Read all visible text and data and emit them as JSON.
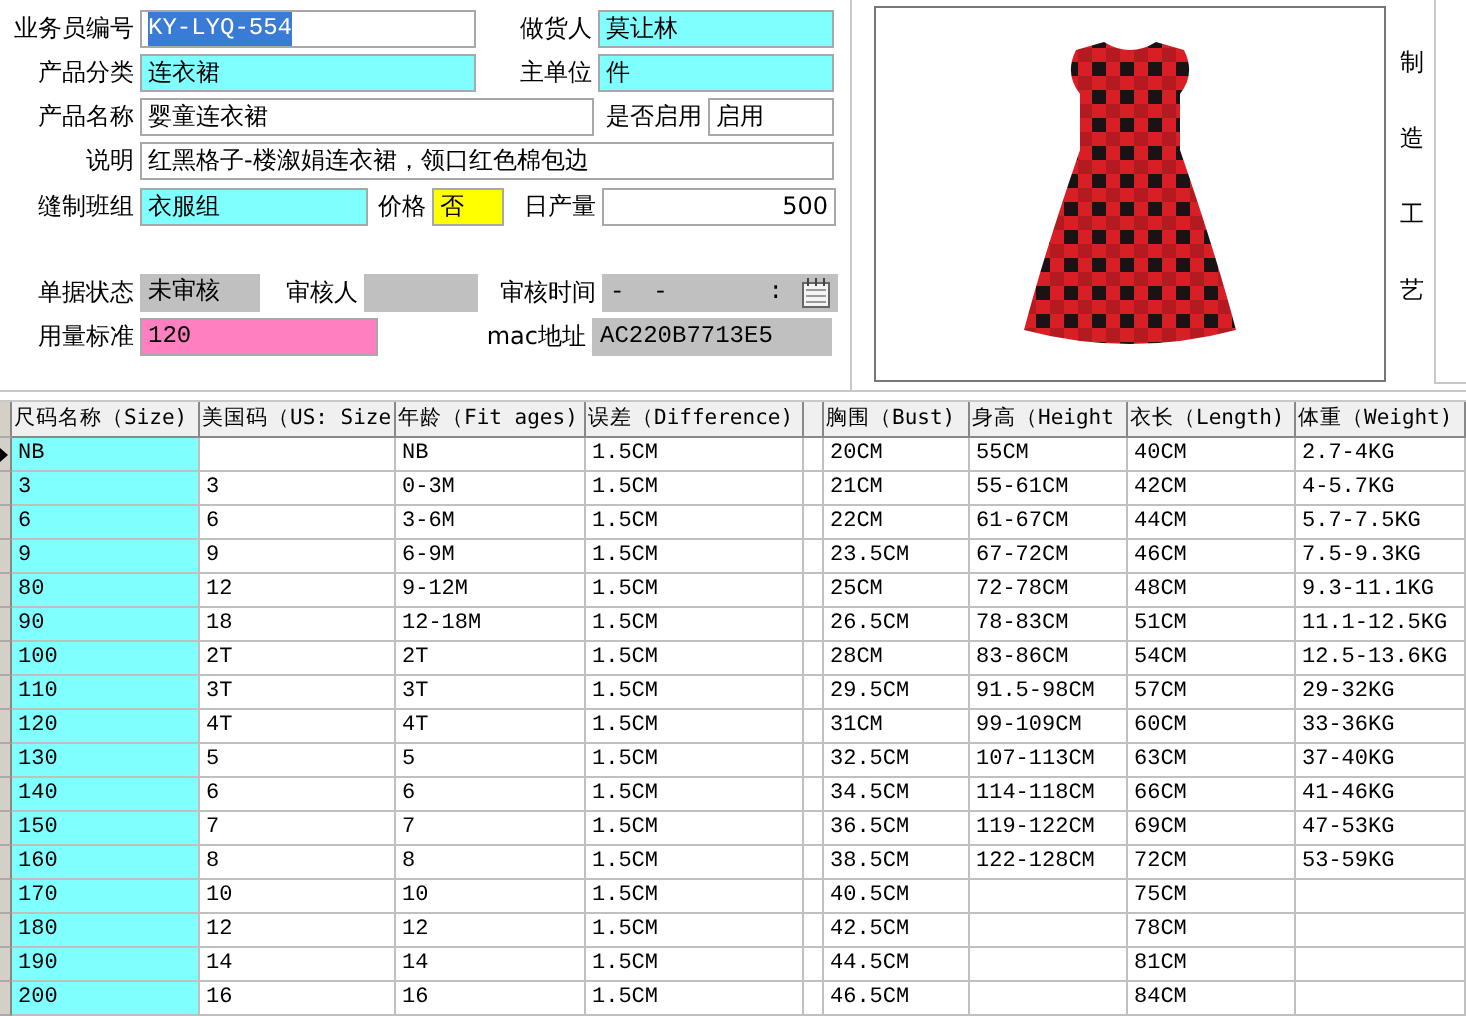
{
  "form": {
    "rows": [
      [
        {
          "label": "业务员编号",
          "value": "KY-LYQ-554",
          "kind": "plain",
          "text_selected": true
        },
        {
          "label": "做货人",
          "value": "莫让林",
          "kind": "required",
          "text_selected": false
        }
      ],
      [
        {
          "label": "产品分类",
          "value": "连衣裙",
          "kind": "required",
          "text_selected": false
        },
        {
          "label": "主单位",
          "value": "件",
          "kind": "required",
          "text_selected": false
        }
      ],
      [
        {
          "label": "产品名称",
          "value": "婴童连衣裙",
          "kind": "plain",
          "text_selected": false
        },
        {
          "label": "是否启用",
          "value": "启用",
          "kind": "plain",
          "text_selected": false
        }
      ],
      [
        {
          "label": "说明",
          "value": "红黑格子-楼溆娟连衣裙，领口红色棉包边",
          "kind": "plain",
          "text_selected": false
        }
      ],
      [
        {
          "label": "缝制班组",
          "value": "衣服组",
          "kind": "required",
          "text_selected": false
        },
        {
          "label": "价格",
          "value": "否",
          "kind": "warning",
          "text_selected": false
        },
        {
          "label": "日产量",
          "value": "500",
          "kind": "number",
          "text_selected": false
        }
      ],
      [
        {
          "label": "单据状态",
          "value": "未审核",
          "kind": "readonly",
          "text_selected": false
        },
        {
          "label": "审核人",
          "kind": "readonly"
        },
        {
          "label": "审核时间",
          "value": "-  -       :",
          "kind": "date",
          "text_selected": false
        }
      ],
      [
        {
          "label": "用量标准",
          "value": "120",
          "kind": "note",
          "text_selected": false
        },
        {
          "label": "mac地址",
          "value": "AC220B7713E5",
          "kind": "readonly",
          "text_selected": false
        }
      ]
    ]
  },
  "side_label": "制造工艺",
  "table": {
    "columns": [
      {
        "label": "尺码名称（Size)"
      },
      {
        "label": "美国码（US: Size"
      },
      {
        "label": "年龄（Fit ages)"
      },
      {
        "label": "误差（Difference)"
      },
      {},
      {
        "label": "胸围（Bust)"
      },
      {
        "label": "身高（Height"
      },
      {
        "label": "衣长（Length)"
      },
      {
        "label": "体重（Weight)"
      }
    ],
    "rows": [
      {
        "selected": true,
        "cells": [
          "NB",
          null,
          "NB",
          "1.5CM",
          null,
          "20CM",
          "55CM",
          "40CM",
          "2.7-4KG"
        ]
      },
      {
        "selected": false,
        "cells": [
          "3",
          "3",
          "0-3M",
          "1.5CM",
          null,
          "21CM",
          "55-61CM",
          "42CM",
          "4-5.7KG"
        ]
      },
      {
        "selected": false,
        "cells": [
          "6",
          "6",
          "3-6M",
          "1.5CM",
          null,
          "22CM",
          "61-67CM",
          "44CM",
          "5.7-7.5KG"
        ]
      },
      {
        "selected": false,
        "cells": [
          "9",
          "9",
          "6-9M",
          "1.5CM",
          null,
          "23.5CM",
          "67-72CM",
          "46CM",
          "7.5-9.3KG"
        ]
      },
      {
        "selected": false,
        "cells": [
          "80",
          "12",
          "9-12M",
          "1.5CM",
          null,
          "25CM",
          "72-78CM",
          "48CM",
          "9.3-11.1KG"
        ]
      },
      {
        "selected": false,
        "cells": [
          "90",
          "18",
          "12-18M",
          "1.5CM",
          null,
          "26.5CM",
          "78-83CM",
          "51CM",
          "11.1-12.5KG"
        ]
      },
      {
        "selected": false,
        "cells": [
          "100",
          "2T",
          "2T",
          "1.5CM",
          null,
          "28CM",
          "83-86CM",
          "54CM",
          "12.5-13.6KG"
        ]
      },
      {
        "selected": false,
        "cells": [
          "110",
          "3T",
          "3T",
          "1.5CM",
          null,
          "29.5CM",
          "91.5-98CM",
          "57CM",
          "29-32KG"
        ]
      },
      {
        "selected": false,
        "cells": [
          "120",
          "4T",
          "4T",
          "1.5CM",
          null,
          "31CM",
          "99-109CM",
          "60CM",
          "33-36KG"
        ]
      },
      {
        "selected": false,
        "cells": [
          "130",
          "5",
          "5",
          "1.5CM",
          null,
          "32.5CM",
          "107-113CM",
          "63CM",
          "37-40KG"
        ]
      },
      {
        "selected": false,
        "cells": [
          "140",
          "6",
          "6",
          "1.5CM",
          null,
          "34.5CM",
          "114-118CM",
          "66CM",
          "41-46KG"
        ]
      },
      {
        "selected": false,
        "cells": [
          "150",
          "7",
          "7",
          "1.5CM",
          null,
          "36.5CM",
          "119-122CM",
          "69CM",
          "47-53KG"
        ]
      },
      {
        "selected": false,
        "cells": [
          "160",
          "8",
          "8",
          "1.5CM",
          null,
          "38.5CM",
          "122-128CM",
          "72CM",
          "53-59KG"
        ]
      },
      {
        "selected": false,
        "cells": [
          "170",
          "10",
          "10",
          "1.5CM",
          null,
          "40.5CM",
          null,
          "75CM",
          null
        ]
      },
      {
        "selected": false,
        "cells": [
          "180",
          "12",
          "12",
          "1.5CM",
          null,
          "42.5CM",
          null,
          "78CM",
          null
        ]
      },
      {
        "selected": false,
        "cells": [
          "190",
          "14",
          "14",
          "1.5CM",
          null,
          "44.5CM",
          null,
          "81CM",
          null
        ]
      },
      {
        "selected": false,
        "cells": [
          "200",
          "16",
          "16",
          "1.5CM",
          null,
          "46.5CM",
          null,
          "84CM",
          null
        ]
      }
    ]
  }
}
